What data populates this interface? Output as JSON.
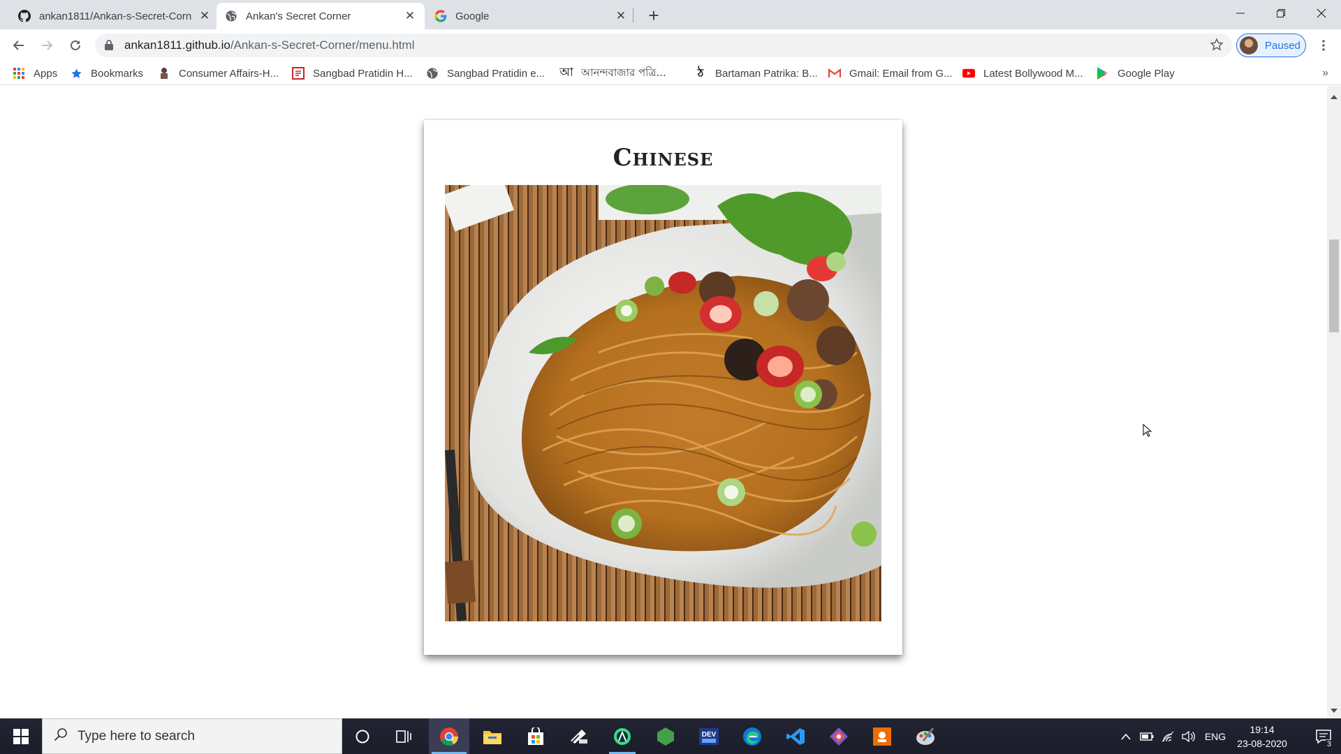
{
  "browser": {
    "tabs": [
      {
        "title": "ankan1811/Ankan-s-Secret-Corn",
        "icon": "github-icon",
        "active": false
      },
      {
        "title": "Ankan's Secret Corner",
        "icon": "globe-icon",
        "active": true
      },
      {
        "title": "Google",
        "icon": "google-icon",
        "active": false
      }
    ],
    "address": {
      "host": "ankan1811.github.io",
      "path": "/Ankan-s-Secret-Corner/menu.html"
    },
    "profile_label": "Paused",
    "bookmarks": [
      {
        "label": "Apps",
        "icon": "apps-grid-icon"
      },
      {
        "label": "Bookmarks",
        "icon": "star-icon"
      },
      {
        "label": "Consumer Affairs-H...",
        "icon": "consumer-affairs-icon"
      },
      {
        "label": "Sangbad Pratidin H...",
        "icon": "sangbad-pratidin-icon"
      },
      {
        "label": "Sangbad Pratidin e...",
        "icon": "globe-icon"
      },
      {
        "label": "আনন্দবাজার পত্রি...",
        "icon": "anandabazar-icon",
        "icon_glyph": "আ"
      },
      {
        "label": "Bartaman Patrika: B...",
        "icon": "bartaman-icon"
      },
      {
        "label": "Gmail: Email from G...",
        "icon": "gmail-icon"
      },
      {
        "label": "Latest Bollywood M...",
        "icon": "youtube-icon"
      },
      {
        "label": "Google Play",
        "icon": "google-play-icon"
      }
    ],
    "bookmarks_more": "»"
  },
  "page": {
    "card_title": "Chinese",
    "image": {
      "subject": "plate of noodles with vegetables and chilies",
      "icon": "noodles-photo"
    }
  },
  "taskbar": {
    "search_placeholder": "Type here to search",
    "apps": [
      "chrome-icon",
      "file-explorer-icon",
      "store-icon",
      "app-icon",
      "android-studio-icon",
      "node-icon",
      "dev-icon",
      "edge-icon",
      "vscode-icon",
      "git-icon",
      "app-orange-icon",
      "app-paint-icon"
    ],
    "language": "ENG",
    "time": "19:14",
    "date": "23-08-2020",
    "notification_count": "3"
  },
  "colors": {
    "tabstrip": "#dee1e6",
    "accent": "#1a73e8",
    "taskbar": "#1f2030"
  }
}
